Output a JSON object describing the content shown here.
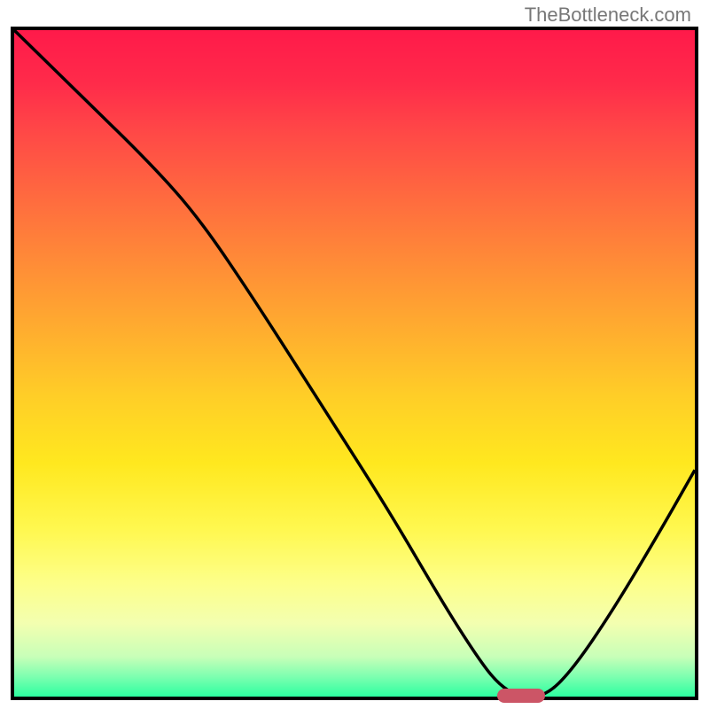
{
  "watermark": "TheBottleneck.com",
  "chart_data": {
    "type": "line",
    "title": "",
    "xlabel": "",
    "ylabel": "",
    "xlim": [
      0,
      100
    ],
    "ylim": [
      0,
      100
    ],
    "x": [
      0,
      10,
      20,
      27,
      35,
      45,
      55,
      63,
      68,
      71,
      74,
      78,
      82,
      88,
      95,
      100
    ],
    "values": [
      100,
      90,
      80,
      72,
      60,
      44,
      28,
      14,
      6,
      2,
      0,
      0,
      4,
      13,
      25,
      34
    ],
    "gradient_stops": [
      {
        "pos": 0,
        "color": "#ff1a4a"
      },
      {
        "pos": 25,
        "color": "#ff6a3f"
      },
      {
        "pos": 50,
        "color": "#ffbe2b"
      },
      {
        "pos": 75,
        "color": "#fff850"
      },
      {
        "pos": 100,
        "color": "#2dffa0"
      }
    ],
    "minimum_marker": {
      "x_start": 71,
      "x_end": 78,
      "y": 0,
      "color": "#cc5566"
    }
  }
}
